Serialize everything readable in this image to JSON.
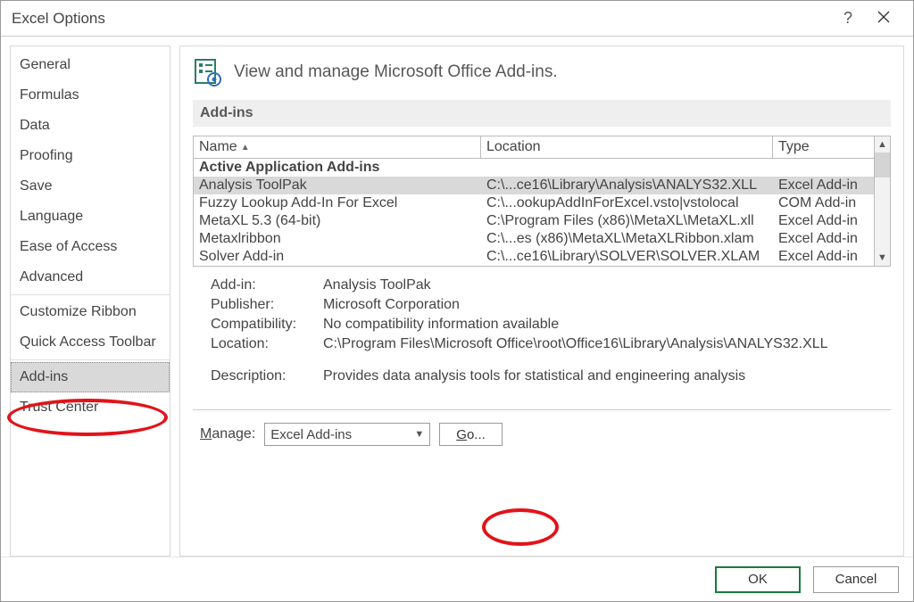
{
  "window": {
    "title": "Excel Options"
  },
  "sidebar": {
    "groups": [
      [
        "General",
        "Formulas",
        "Data",
        "Proofing",
        "Save",
        "Language",
        "Ease of Access",
        "Advanced"
      ],
      [
        "Customize Ribbon",
        "Quick Access Toolbar"
      ],
      [
        "Add-ins",
        "Trust Center"
      ]
    ],
    "selected": "Add-ins"
  },
  "main": {
    "heading": "View and manage Microsoft Office Add-ins.",
    "section": "Add-ins",
    "columns": {
      "name": "Name",
      "location": "Location",
      "type": "Type"
    },
    "group_label": "Active Application Add-ins",
    "rows": [
      {
        "name": "Analysis ToolPak",
        "location": "C:\\...ce16\\Library\\Analysis\\ANALYS32.XLL",
        "type": "Excel Add-in",
        "selected": true
      },
      {
        "name": "Fuzzy Lookup Add-In For Excel",
        "location": "C:\\...ookupAddInForExcel.vsto|vstolocal",
        "type": "COM Add-in"
      },
      {
        "name": "MetaXL 5.3 (64-bit)",
        "location": "C:\\Program Files (x86)\\MetaXL\\MetaXL.xll",
        "type": "Excel Add-in"
      },
      {
        "name": "Metaxlribbon",
        "location": "C:\\...es (x86)\\MetaXL\\MetaXLRibbon.xlam",
        "type": "Excel Add-in"
      },
      {
        "name": "Solver Add-in",
        "location": "C:\\...ce16\\Library\\SOLVER\\SOLVER.XLAM",
        "type": "Excel Add-in"
      }
    ],
    "details": {
      "labels": {
        "addin": "Add-in:",
        "publisher": "Publisher:",
        "compatibility": "Compatibility:",
        "location": "Location:",
        "description": "Description:"
      },
      "values": {
        "addin": "Analysis ToolPak",
        "publisher": "Microsoft Corporation",
        "compatibility": "No compatibility information available",
        "location": "C:\\Program Files\\Microsoft Office\\root\\Office16\\Library\\Analysis\\ANALYS32.XLL",
        "description": "Provides data analysis tools for statistical and engineering analysis"
      }
    },
    "manage": {
      "label_html": "Manage:",
      "label_accel": "M",
      "dropdown": "Excel Add-ins",
      "go_label": "Go...",
      "go_accel": "G"
    }
  },
  "footer": {
    "ok": "OK",
    "cancel": "Cancel"
  }
}
